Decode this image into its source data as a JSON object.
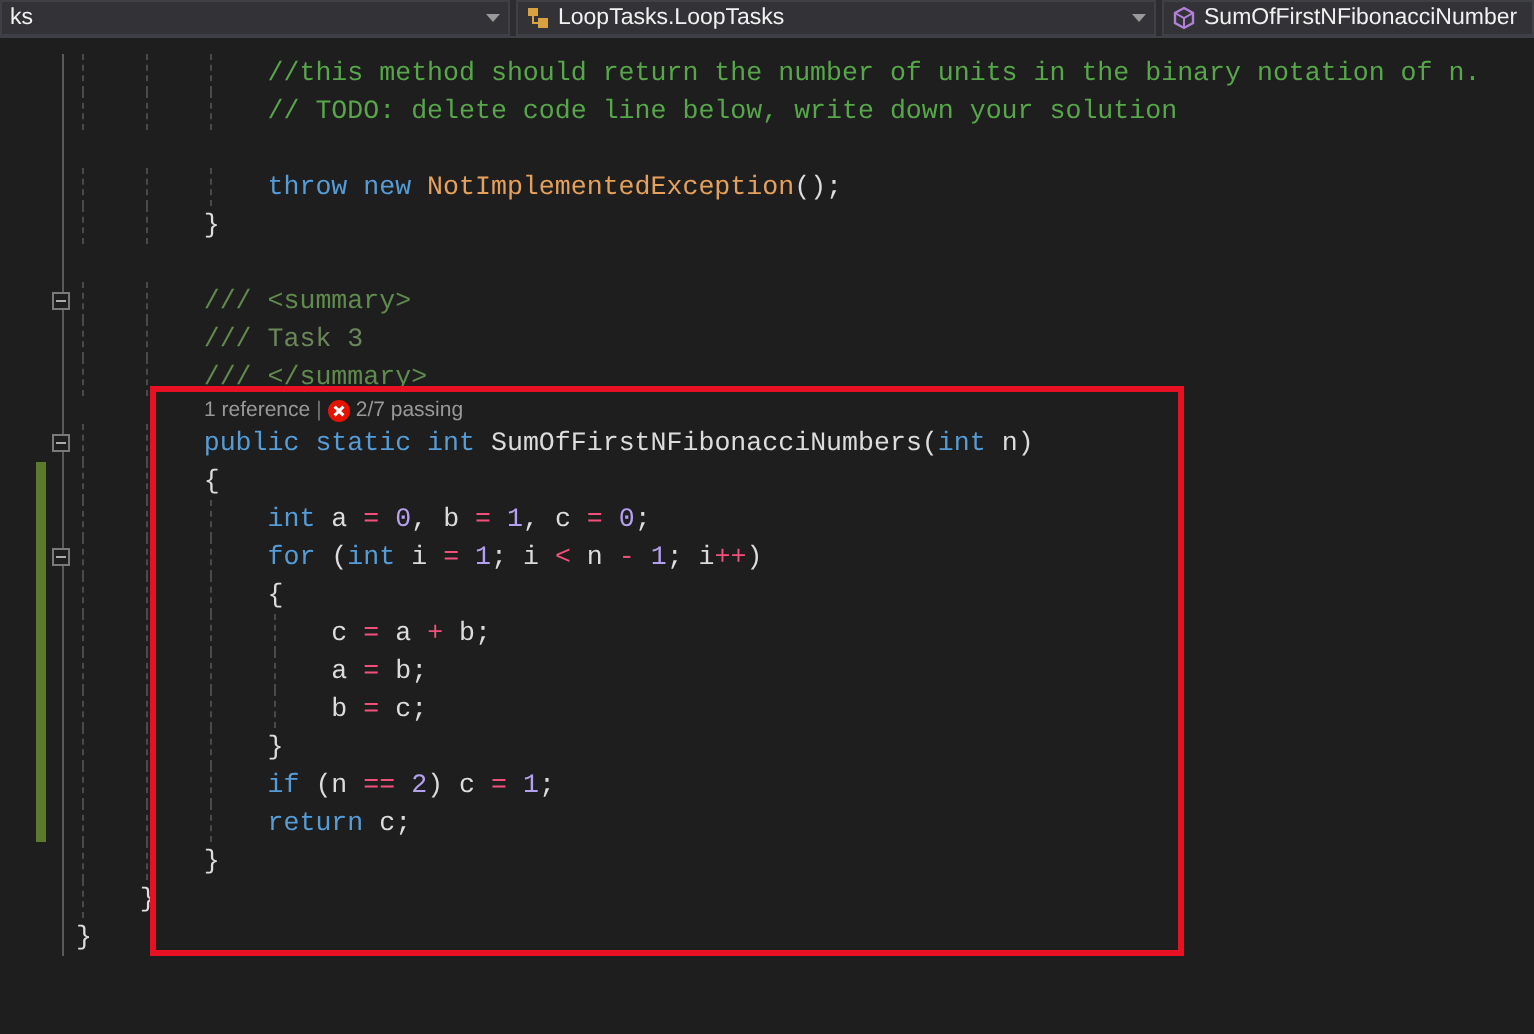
{
  "navbar": [
    {
      "label": "ks"
    },
    {
      "label": "LoopTasks.LoopTasks"
    },
    {
      "label": "SumOfFirstNFibonacciNumber"
    }
  ],
  "editor": {
    "lines": [
      {
        "kind": "code",
        "changed": false,
        "fold": false,
        "tokens": [
          {
            "text": "            //this method should return the number of units in the binary notation of n.",
            "kind": "cm"
          }
        ]
      },
      {
        "kind": "code",
        "changed": false,
        "fold": false,
        "tokens": [
          {
            "text": "            // TODO: delete code line below, write down your solution",
            "kind": "cm"
          }
        ]
      },
      {
        "kind": "blank"
      },
      {
        "kind": "code",
        "changed": false,
        "fold": false,
        "tokens": [
          {
            "text": "            throw",
            "kind": "kw"
          },
          {
            "text": " new",
            "kind": "kw"
          },
          {
            "text": " NotImplementedException",
            "kind": "ty"
          },
          {
            "text": "();",
            "kind": "pl"
          }
        ]
      },
      {
        "kind": "code",
        "changed": false,
        "fold": false,
        "tokens": [
          {
            "text": "        }",
            "kind": "pl"
          }
        ]
      },
      {
        "kind": "blank"
      },
      {
        "kind": "code",
        "changed": false,
        "fold": true,
        "tokens": [
          {
            "text": "        ///",
            "kind": "doc"
          },
          {
            "text": " <summary>",
            "kind": "tag"
          }
        ]
      },
      {
        "kind": "code",
        "changed": false,
        "fold": false,
        "tokens": [
          {
            "text": "        ///",
            "kind": "doc"
          },
          {
            "text": " Task 3",
            "kind": "doctext"
          }
        ]
      },
      {
        "kind": "code",
        "changed": false,
        "fold": false,
        "tokens": [
          {
            "text": "        ///",
            "kind": "doc"
          },
          {
            "text": " </summary>",
            "kind": "tag"
          }
        ]
      },
      {
        "kind": "lens",
        "changed": false,
        "fold": false,
        "references": "1 reference",
        "separator": "|",
        "tests": "2/7 passing",
        "all_passed": false
      },
      {
        "kind": "code",
        "changed": false,
        "fold": true,
        "tokens": [
          {
            "text": "        public",
            "kind": "kw"
          },
          {
            "text": " static",
            "kind": "kw"
          },
          {
            "text": " int",
            "kind": "kw"
          },
          {
            "text": " SumOfFirstNFibonacciNumbers(",
            "kind": "pl"
          },
          {
            "text": "int",
            "kind": "kw"
          },
          {
            "text": " n)",
            "kind": "pl"
          }
        ]
      },
      {
        "kind": "code",
        "changed": true,
        "fold": false,
        "tokens": [
          {
            "text": "        {",
            "kind": "pl"
          }
        ]
      },
      {
        "kind": "code",
        "changed": true,
        "fold": false,
        "tokens": [
          {
            "text": "            int",
            "kind": "kw"
          },
          {
            "text": " a ",
            "kind": "pl"
          },
          {
            "text": "=",
            "kind": "op"
          },
          {
            "text": " 0",
            "kind": "num"
          },
          {
            "text": ", b ",
            "kind": "pl"
          },
          {
            "text": "=",
            "kind": "op"
          },
          {
            "text": " 1",
            "kind": "num"
          },
          {
            "text": ", c ",
            "kind": "pl"
          },
          {
            "text": "=",
            "kind": "op"
          },
          {
            "text": " 0",
            "kind": "num"
          },
          {
            "text": ";",
            "kind": "pl"
          }
        ]
      },
      {
        "kind": "code",
        "changed": true,
        "fold": true,
        "tokens": [
          {
            "text": "            for",
            "kind": "kw"
          },
          {
            "text": " (",
            "kind": "pl"
          },
          {
            "text": "int",
            "kind": "kw"
          },
          {
            "text": " i ",
            "kind": "pl"
          },
          {
            "text": "=",
            "kind": "op"
          },
          {
            "text": " 1",
            "kind": "num"
          },
          {
            "text": "; i ",
            "kind": "pl"
          },
          {
            "text": "<",
            "kind": "op"
          },
          {
            "text": " n ",
            "kind": "pl"
          },
          {
            "text": "-",
            "kind": "op"
          },
          {
            "text": " 1",
            "kind": "num"
          },
          {
            "text": "; i",
            "kind": "pl"
          },
          {
            "text": "++",
            "kind": "op"
          },
          {
            "text": ")",
            "kind": "pl"
          }
        ]
      },
      {
        "kind": "code",
        "changed": true,
        "fold": false,
        "tokens": [
          {
            "text": "            {",
            "kind": "pl"
          }
        ]
      },
      {
        "kind": "code",
        "changed": true,
        "fold": false,
        "tokens": [
          {
            "text": "                c ",
            "kind": "pl"
          },
          {
            "text": "=",
            "kind": "op"
          },
          {
            "text": " a ",
            "kind": "pl"
          },
          {
            "text": "+",
            "kind": "op"
          },
          {
            "text": " b;",
            "kind": "pl"
          }
        ]
      },
      {
        "kind": "code",
        "changed": true,
        "fold": false,
        "tokens": [
          {
            "text": "                a ",
            "kind": "pl"
          },
          {
            "text": "=",
            "kind": "op"
          },
          {
            "text": " b;",
            "kind": "pl"
          }
        ]
      },
      {
        "kind": "code",
        "changed": true,
        "fold": false,
        "tokens": [
          {
            "text": "                b ",
            "kind": "pl"
          },
          {
            "text": "=",
            "kind": "op"
          },
          {
            "text": " c;",
            "kind": "pl"
          }
        ]
      },
      {
        "kind": "code",
        "changed": true,
        "fold": false,
        "tokens": [
          {
            "text": "            }",
            "kind": "pl"
          }
        ]
      },
      {
        "kind": "code",
        "changed": true,
        "fold": false,
        "tokens": [
          {
            "text": "            if",
            "kind": "kw"
          },
          {
            "text": " (n ",
            "kind": "pl"
          },
          {
            "text": "==",
            "kind": "op"
          },
          {
            "text": " 2",
            "kind": "num"
          },
          {
            "text": ") c ",
            "kind": "pl"
          },
          {
            "text": "=",
            "kind": "op"
          },
          {
            "text": " 1",
            "kind": "num"
          },
          {
            "text": ";",
            "kind": "pl"
          }
        ]
      },
      {
        "kind": "code",
        "changed": true,
        "fold": false,
        "tokens": [
          {
            "text": "            return",
            "kind": "kw"
          },
          {
            "text": " c;",
            "kind": "pl"
          }
        ]
      },
      {
        "kind": "code",
        "changed": false,
        "fold": false,
        "tokens": [
          {
            "text": "        }",
            "kind": "pl"
          }
        ]
      },
      {
        "kind": "code",
        "changed": false,
        "fold": false,
        "tokens": [
          {
            "text": "    }",
            "kind": "pl"
          }
        ]
      },
      {
        "kind": "code",
        "changed": false,
        "fold": false,
        "tokens": [
          {
            "text": "}",
            "kind": "pl"
          }
        ]
      }
    ]
  }
}
